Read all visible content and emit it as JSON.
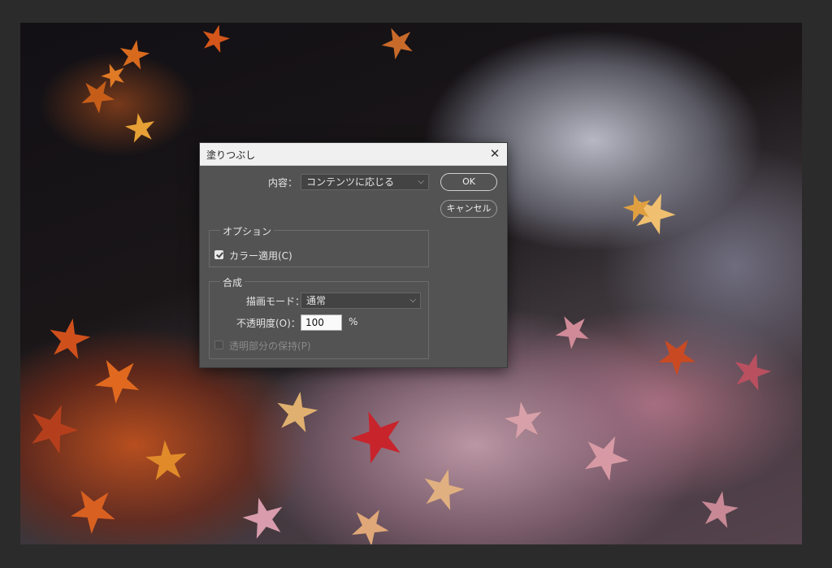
{
  "dialog": {
    "title": "塗りつぶし",
    "content_label": "内容：",
    "content_value": "コンテンツに応じる",
    "ok_label": "OK",
    "cancel_label": "キャンセル",
    "options": {
      "group_title": "オプション",
      "color_adapt_label": "カラー適用(C)",
      "color_adapt_checked": true
    },
    "blending": {
      "group_title": "合成",
      "mode_label": "描画モード：",
      "mode_value": "通常",
      "opacity_label": "不透明度(O)：",
      "opacity_value": "100",
      "opacity_unit": "%",
      "preserve_transparency_label": "透明部分の保持(P)",
      "preserve_transparency_checked": false,
      "preserve_transparency_enabled": false
    }
  },
  "colors": {
    "dialog_bg": "#535353",
    "titlebar_bg": "#f0f0f0",
    "workspace_bg": "#2b2b2b"
  }
}
